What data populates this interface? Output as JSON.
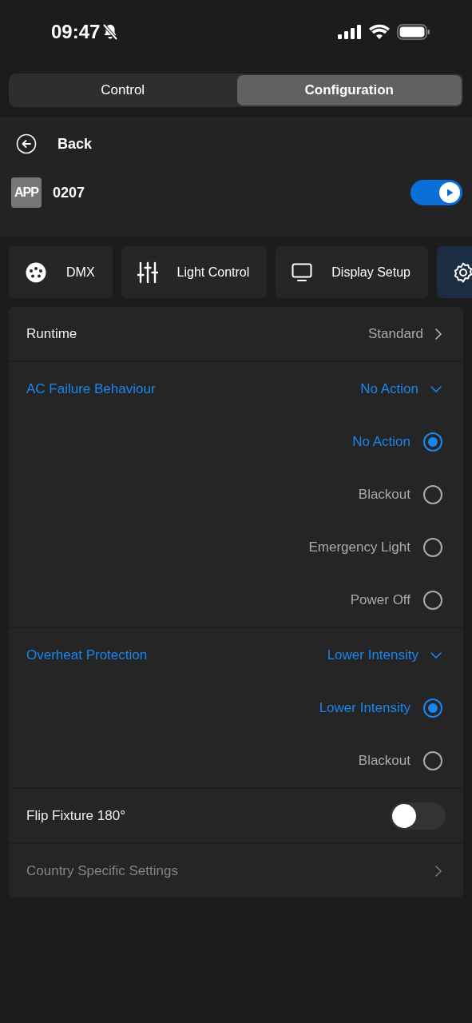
{
  "status_bar": {
    "time": "09:47",
    "silent": true
  },
  "mode_tabs": [
    {
      "label": "Control",
      "selected": false
    },
    {
      "label": "Configuration",
      "selected": true
    }
  ],
  "header": {
    "back": "Back",
    "device_badge": "APP",
    "device_name": "0207",
    "device_on": true
  },
  "categories": [
    {
      "kind": "dmx",
      "label": "DMX",
      "selected": false
    },
    {
      "kind": "sliders",
      "label": "Light Control",
      "selected": false
    },
    {
      "kind": "display",
      "label": "Display Setup",
      "selected": false
    },
    {
      "kind": "gear",
      "selected": true
    }
  ],
  "settings": [
    {
      "kind": "link",
      "label": "Runtime",
      "value": "Standard",
      "disabled": false
    },
    {
      "kind": "dropdown",
      "label": "AC Failure Behaviour",
      "value": "No Action",
      "expanded": true,
      "options": [
        {
          "label": "No Action",
          "selected": true
        },
        {
          "label": "Blackout",
          "selected": false
        },
        {
          "label": "Emergency Light",
          "selected": false
        },
        {
          "label": "Power Off",
          "selected": false
        }
      ]
    },
    {
      "kind": "dropdown",
      "label": "Overheat Protection",
      "value": "Lower Intensity",
      "expanded": true,
      "options": [
        {
          "label": "Lower Intensity",
          "selected": true
        },
        {
          "label": "Blackout",
          "selected": false
        }
      ]
    },
    {
      "kind": "toggle",
      "label": "Flip Fixture 180°",
      "on": false
    },
    {
      "kind": "link",
      "label": "Country Specific Settings",
      "disabled": true
    }
  ]
}
